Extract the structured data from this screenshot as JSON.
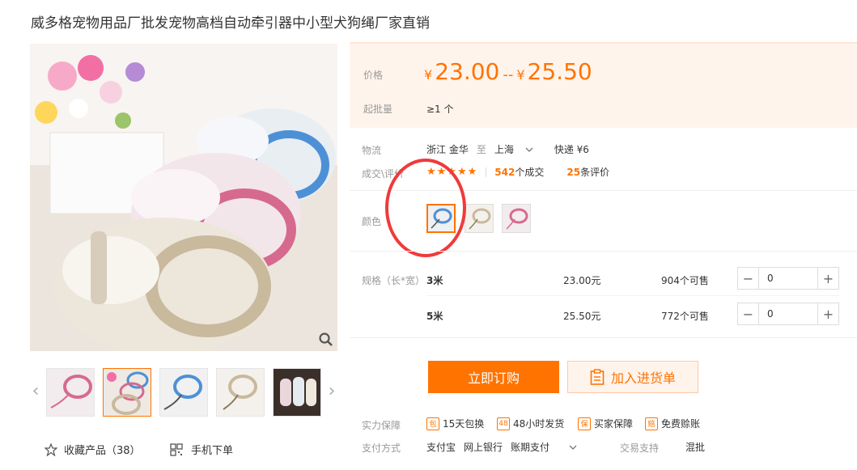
{
  "title": "威多格宠物用品厂批发宠物高档自动牵引器中小型犬狗绳厂家直销",
  "price": {
    "label": "价格",
    "currency": "¥",
    "low": "23.00",
    "separator": "--",
    "high": "25.50"
  },
  "moq": {
    "label": "起批量",
    "value": "≥1 个"
  },
  "logistics": {
    "label": "物流",
    "from": "浙江 金华",
    "to_word": "至",
    "to": "上海",
    "shipping": "快递 ¥6"
  },
  "deals": {
    "label": "成交\\评价",
    "stars": "★★★★★",
    "sold_count": "542",
    "sold_suffix": "个成交",
    "review_count": "25",
    "review_suffix": "条评价"
  },
  "color": {
    "label": "颜色"
  },
  "spec": {
    "label": "规格（长*宽）",
    "rows": [
      {
        "name": "3米",
        "price": "23.00元",
        "stock": "904个可售",
        "qty": "0"
      },
      {
        "name": "5米",
        "price": "25.50元",
        "stock": "772个可售",
        "qty": "0"
      }
    ]
  },
  "buttons": {
    "buy": "立即订购",
    "cart": "加入进货单"
  },
  "guarantee": {
    "label": "实力保障",
    "items": [
      {
        "icon": "包",
        "text": "15天包换"
      },
      {
        "icon": "48",
        "text": "48小时发货"
      },
      {
        "icon": "保",
        "text": "买家保障"
      },
      {
        "icon": "赔",
        "text": "免费赊账"
      }
    ]
  },
  "payment": {
    "label": "支付方式",
    "methods": [
      "支付宝",
      "网上银行",
      "账期支付"
    ]
  },
  "trade": {
    "label": "交易支持",
    "value": "混批"
  },
  "favorite": {
    "label": "收藏产品（38）"
  },
  "mobile_order": {
    "label": "手机下单"
  },
  "colors": {
    "accent": "#ff7300",
    "price_bg": "#fff4ec",
    "annotation_circle": "#f03a3a"
  }
}
